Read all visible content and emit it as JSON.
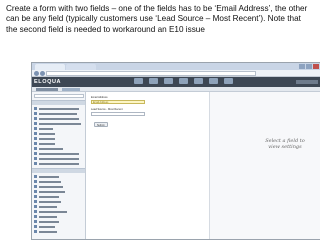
{
  "caption": "Create a form with two fields – one of the fields has to be ‘Email Address’, the other can be any field (typically customers use ‘Lead Source – Most Recent’). Note that the second field is needed to workaround an E10 issue",
  "app": {
    "logo": "ELOQUA"
  },
  "form": {
    "email_label": "Email Address",
    "email_value": "Email Address",
    "lead_label": "Lead Source - Most Recent",
    "submit_label": "Submit"
  },
  "settings": {
    "hint": "Select a field to view settings"
  }
}
